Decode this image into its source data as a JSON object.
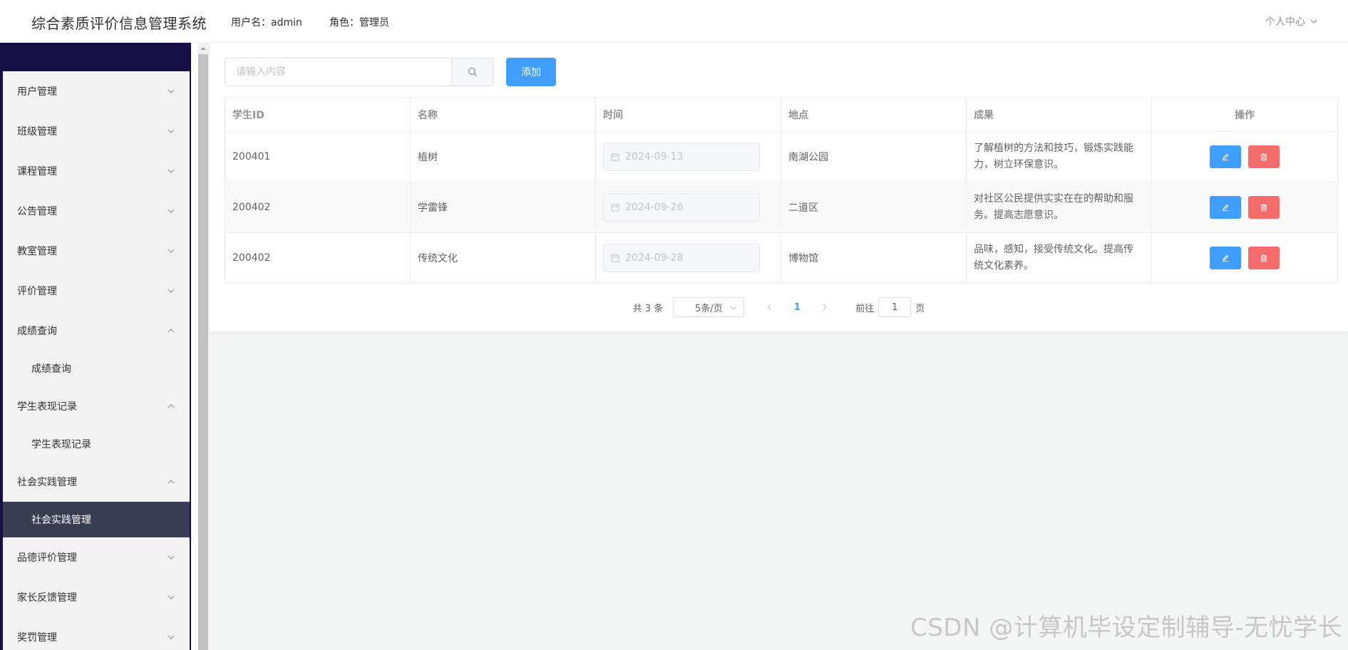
{
  "header": {
    "title": "综合素质评价信息管理系统",
    "username": "用户名：admin",
    "role": "角色：管理员",
    "personal_center": "个人中心"
  },
  "sidebar": {
    "items": [
      {
        "label": "用户管理",
        "expanded": false
      },
      {
        "label": "班级管理",
        "expanded": false
      },
      {
        "label": "课程管理",
        "expanded": false
      },
      {
        "label": "公告管理",
        "expanded": false
      },
      {
        "label": "教室管理",
        "expanded": false
      },
      {
        "label": "评价管理",
        "expanded": false
      },
      {
        "label": "成绩查询",
        "expanded": true,
        "sub": "成绩查询"
      },
      {
        "label": "学生表现记录",
        "expanded": true,
        "sub": "学生表现记录"
      },
      {
        "label": "社会实践管理",
        "expanded": true,
        "sub": "社会实践管理",
        "active": true
      },
      {
        "label": "品德评价管理",
        "expanded": false
      },
      {
        "label": "家长反馈管理",
        "expanded": false
      },
      {
        "label": "奖罚管理",
        "expanded": false
      }
    ]
  },
  "toolbar": {
    "search_placeholder": "请输入内容",
    "add_label": "添加"
  },
  "table": {
    "columns": [
      "学生ID",
      "名称",
      "时间",
      "地点",
      "成果",
      "操作"
    ],
    "rows": [
      {
        "student_id": "200401",
        "name": "植树",
        "date": "2024-09-13",
        "place": "南湖公园",
        "result": "了解植树的方法和技巧，锻炼实践能力，树立环保意识。"
      },
      {
        "student_id": "200402",
        "name": "学雷锋",
        "date": "2024-09-26",
        "place": "二道区",
        "result": "对社区公民提供实实在在的帮助和服务。提高志愿意识。"
      },
      {
        "student_id": "200402",
        "name": "传统文化",
        "date": "2024-09-28",
        "place": "博物馆",
        "result": "品味，感知，接受传统文化。提高传统文化素养。"
      }
    ]
  },
  "pagination": {
    "total": "共 3 条",
    "page_size": "5条/页",
    "current_page": "1",
    "goto_prefix": "前往",
    "goto_value": "1",
    "goto_suffix": "页"
  },
  "watermark": "CSDN @计算机毕设定制辅导-无忧学长",
  "colors": {
    "primary": "#409eff",
    "danger": "#f56c6c",
    "sidebar_dark": "#160f44",
    "active_item": "#373d52"
  },
  "icons": {
    "search": "search-icon",
    "calendar": "calendar-icon",
    "edit": "edit-icon",
    "delete": "delete-icon",
    "chevron": "chevron-down-icon"
  }
}
